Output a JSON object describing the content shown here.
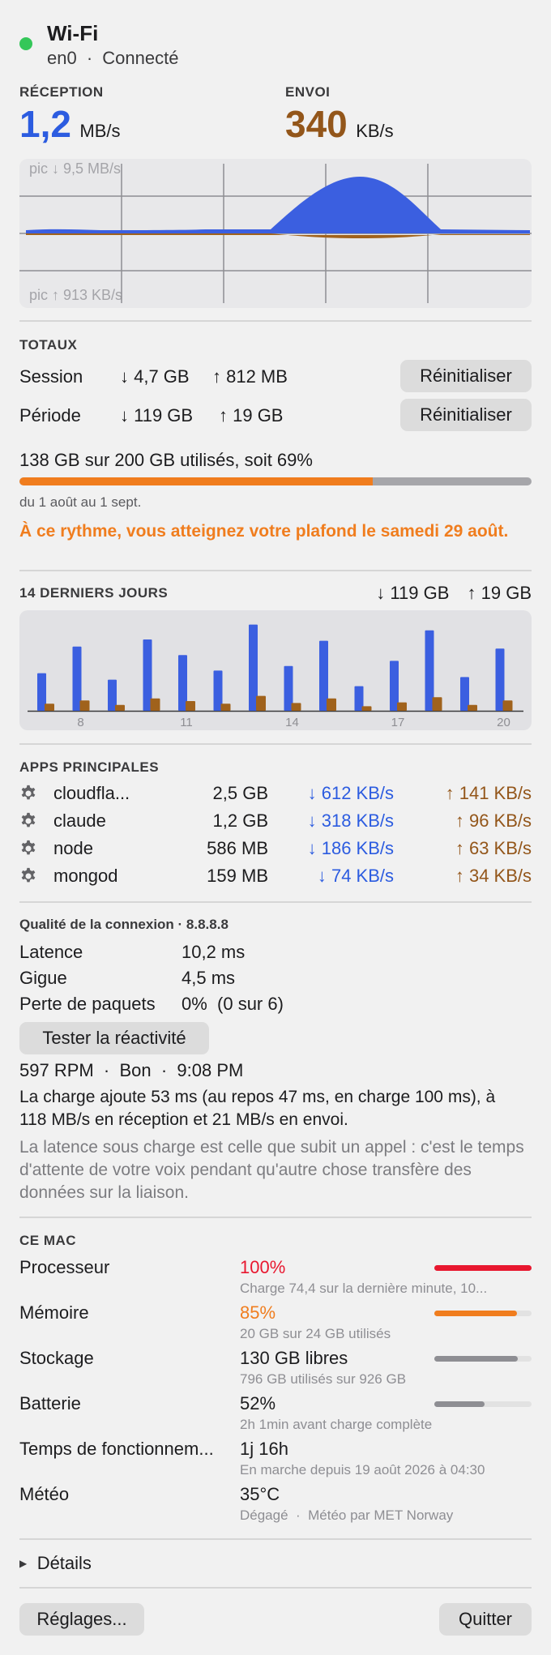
{
  "header": {
    "title": "Wi-Fi",
    "interface": "en0",
    "separator": "·",
    "status": "Connecté",
    "status_color": "#34c759"
  },
  "rates": {
    "rx_label": "RÉCEPTION",
    "rx_value": "1,2",
    "rx_unit": "MB/s",
    "tx_label": "ENVOI",
    "tx_value": "340",
    "tx_unit": "KB/s"
  },
  "graph": {
    "peak_rx": "pic ↓ 9,5 MB/s",
    "peak_tx": "pic ↑ 913 KB/s",
    "rx_color": "#3b5fe0",
    "tx_color": "#a0621c"
  },
  "totals": {
    "title": "TOTAUX",
    "rows": [
      {
        "label": "Session",
        "down": "↓ 4,7 GB",
        "up": "↑ 812 MB",
        "button": "Réinitialiser"
      },
      {
        "label": "Période",
        "down": "↓ 119 GB",
        "up": "↑ 19 GB",
        "button": "Réinitialiser"
      }
    ],
    "usage_text": "138 GB sur 200 GB utilisés, soit 69%",
    "usage_fraction": 0.69,
    "usage_color": "#f07d1e",
    "period": "du 1 août au 1 sept.",
    "warning": "À ce rythme, vous atteignez votre plafond le samedi 29 août."
  },
  "days": {
    "title": "14 DERNIERS JOURS",
    "down_total": "↓ 119 GB",
    "up_total": "↑ 19 GB",
    "ticks": [
      "8",
      "11",
      "14",
      "17",
      "20"
    ]
  },
  "chart_data": {
    "type": "bar",
    "categories": [
      "7",
      "8",
      "9",
      "10",
      "11",
      "12",
      "13",
      "14",
      "15",
      "16",
      "17",
      "18",
      "19",
      "20"
    ],
    "series": [
      {
        "values": [
          5.8,
          9.9,
          4.8,
          11.0,
          8.6,
          6.2,
          13.3,
          6.9,
          10.8,
          3.8,
          7.7,
          12.4,
          5.2,
          9.6
        ]
      },
      {
        "values": [
          1.1,
          1.6,
          0.9,
          1.9,
          1.5,
          1.1,
          2.3,
          1.2,
          1.9,
          0.7,
          1.3,
          2.1,
          0.9,
          1.6
        ]
      }
    ],
    "colors": [
      "#3b5fe0",
      "#a0621c"
    ],
    "xlabel": "",
    "ylabel": "",
    "ylim": [
      0,
      14
    ]
  },
  "apps": {
    "title": "APPS PRINCIPALES",
    "items": [
      {
        "name": "cloudfla...",
        "total": "2,5 GB",
        "down": "↓ 612 KB/s",
        "up": "↑ 141 KB/s"
      },
      {
        "name": "claude",
        "total": "1,2 GB",
        "down": "↓ 318 KB/s",
        "up": "↑ 96 KB/s"
      },
      {
        "name": "node",
        "total": "586 MB",
        "down": "↓ 186 KB/s",
        "up": "↑ 63 KB/s"
      },
      {
        "name": "mongod",
        "total": "159 MB",
        "down": "↓ 74 KB/s",
        "up": "↑ 34 KB/s"
      }
    ]
  },
  "quality": {
    "title": "Qualité de la connexion · 8.8.8.8",
    "rows": [
      {
        "label": "Latence",
        "value": "10,2 ms"
      },
      {
        "label": "Gigue",
        "value": "4,5 ms"
      },
      {
        "label": "Perte de paquets",
        "value": "0%  (0 sur 6)"
      }
    ],
    "test_button": "Tester la réactivité",
    "result": "597 RPM  ·  Bon  ·  9:08 PM",
    "detail": "La charge ajoute 53 ms (au repos 47 ms, en charge 100 ms), à 118 MB/s en réception et 21 MB/s en envoi.",
    "explain": "La latence sous charge est celle que subit un appel : c'est le temps d'attente de votre voix pendant qu'autre chose transfère des données sur la liaison."
  },
  "mac": {
    "title": "CE MAC",
    "rows": [
      {
        "label": "Processeur",
        "value": "100%",
        "sub": "Charge 74,4 sur la dernière minute, 10...",
        "level": 1.0,
        "color": "#e8172f"
      },
      {
        "label": "Mémoire",
        "value": "85%",
        "sub": "20 GB sur 24 GB utilisés",
        "level": 0.85,
        "color": "#f07d1e"
      },
      {
        "label": "Stockage",
        "value": "130 GB libres",
        "sub": "796 GB utilisés sur 926 GB",
        "level": 0.86,
        "color": "#8e8e93"
      },
      {
        "label": "Batterie",
        "value": "52%",
        "sub": "2h 1min avant charge complète",
        "level": 0.52,
        "color": "#8e8e93"
      },
      {
        "label": "Temps de fonctionnem...",
        "value": "1j 16h",
        "sub": "En marche depuis 19 août 2026 à 04:30"
      },
      {
        "label": "Météo",
        "value": "35°C",
        "sub": "Dégagé  ·  Météo par MET Norway"
      }
    ]
  },
  "details": {
    "label": "Détails"
  },
  "footer": {
    "settings": "Réglages...",
    "quit": "Quitter"
  }
}
